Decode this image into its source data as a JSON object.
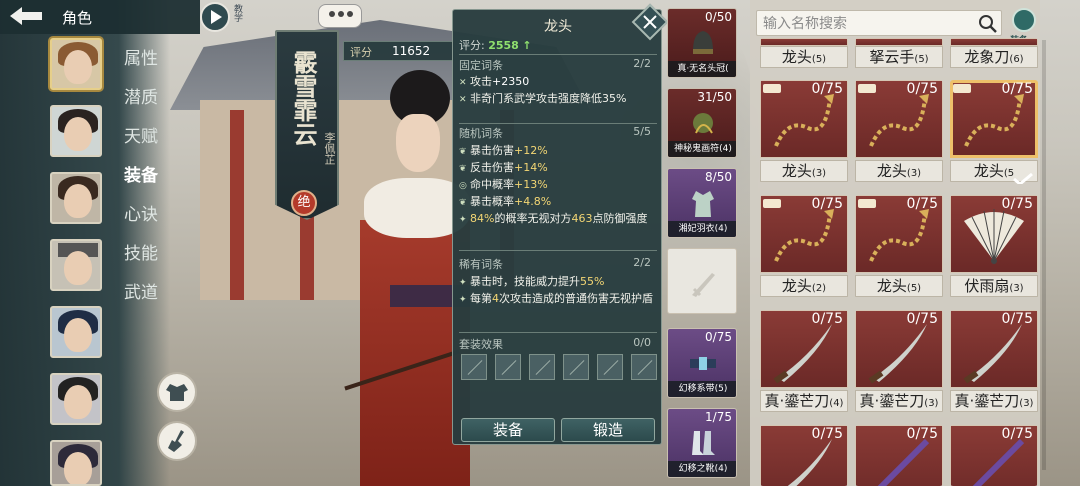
{
  "header": {
    "title": "角色",
    "tutorial_label": "教学"
  },
  "nav": {
    "items": [
      {
        "label": "属性"
      },
      {
        "label": "潜质"
      },
      {
        "label": "天赋"
      },
      {
        "label": "装备"
      },
      {
        "label": "心诀"
      },
      {
        "label": "技能"
      },
      {
        "label": "武道"
      }
    ],
    "active": "装备"
  },
  "character": {
    "name": "霰雪霏云",
    "sub_name": "李佩芷",
    "badge": "绝",
    "score_label": "评分",
    "score": "11652"
  },
  "item_panel": {
    "title": "龙头",
    "score_label": "评分:",
    "score": "2558",
    "score_arrow": "↑",
    "fixed": {
      "label": "固定词条",
      "count": "2/2",
      "attrs": [
        {
          "icon": "sword-icon",
          "text": "攻击",
          "value": "+2350"
        },
        {
          "icon": "sword-icon",
          "text": "非奇门系武学攻击强度降低35%",
          "value": ""
        }
      ]
    },
    "random": {
      "label": "随机词条",
      "count": "5/5",
      "attrs": [
        {
          "icon": "leaf-icon",
          "text": "暴击伤害",
          "value": "+12%"
        },
        {
          "icon": "leaf-icon",
          "text": "反击伤害",
          "value": "+14%"
        },
        {
          "icon": "target-icon",
          "text": "命中概率",
          "value": "+13%"
        },
        {
          "icon": "leaf-icon",
          "text": "暴击概率",
          "value": "+4.8%"
        }
      ],
      "special": {
        "pre": "84%",
        "mid": "的概率无视对方",
        "num": "463",
        "post": "点防御强度"
      }
    },
    "rare": {
      "label": "稀有词条",
      "count": "2/2",
      "attr1": {
        "pre": "暴击时，技能威力提升",
        "value": "55%"
      },
      "attr2": {
        "pre": "每第",
        "num": "4",
        "post": "次攻击造成的普通伤害无视护盾"
      }
    },
    "set": {
      "label": "套装效果",
      "count": "0/0"
    },
    "buttons": {
      "equip": "装备",
      "forge": "锻造"
    }
  },
  "mid_items": [
    {
      "count": "0/50",
      "name": "真·无名头冠(",
      "color": "red"
    },
    {
      "count": "31/50",
      "name": "神秘鬼画符(4)",
      "color": "red"
    },
    {
      "count": "8/50",
      "name": "湘妃羽衣(4)",
      "color": "purple"
    },
    {
      "count": "",
      "name": "",
      "color": "empty"
    },
    {
      "count": "0/75",
      "name": "幻移系带(5)",
      "color": "purple"
    },
    {
      "count": "1/75",
      "name": "幻移之靴(4)",
      "color": "purple"
    }
  ],
  "search": {
    "placeholder": "输入名称搜索"
  },
  "equip_toggle": {
    "label": "装备"
  },
  "grid_top": [
    {
      "name": "龙头",
      "lv": "(5)"
    },
    {
      "name": "拏云手",
      "lv": "(5)"
    },
    {
      "name": "龙象刀",
      "lv": "(6)"
    }
  ],
  "grid_rows": [
    [
      {
        "count": "0/75",
        "name": "龙头",
        "lv": "(3)",
        "icon": "chain-icon"
      },
      {
        "count": "0/75",
        "name": "龙头",
        "lv": "(3)",
        "icon": "chain-icon"
      },
      {
        "count": "0/75",
        "name": "龙头",
        "lv": "(5",
        "icon": "chain-icon",
        "selected": true
      }
    ],
    [
      {
        "count": "0/75",
        "name": "龙头",
        "lv": "(2)",
        "icon": "chain-icon"
      },
      {
        "count": "0/75",
        "name": "龙头",
        "lv": "(5)",
        "icon": "chain-icon"
      },
      {
        "count": "0/75",
        "name": "伏雨扇",
        "lv": "(3)",
        "icon": "fan-icon"
      }
    ],
    [
      {
        "count": "0/75",
        "name": "真·鎏芒刀",
        "lv": "(4)",
        "icon": "blade-icon"
      },
      {
        "count": "0/75",
        "name": "真·鎏芒刀",
        "lv": "(3)",
        "icon": "blade-icon"
      },
      {
        "count": "0/75",
        "name": "真·鎏芒刀",
        "lv": "(3)",
        "icon": "blade-icon"
      }
    ],
    [
      {
        "count": "0/75",
        "name": "",
        "lv": "",
        "icon": "blade-icon"
      },
      {
        "count": "0/75",
        "name": "",
        "lv": "",
        "icon": "staff-icon"
      },
      {
        "count": "0/75",
        "name": "",
        "lv": "",
        "icon": "staff-icon"
      }
    ]
  ],
  "colors": {
    "accent_green": "#8fdf6e",
    "accent_yellow": "#f3d674",
    "panel_bg": "#283c3e",
    "item_red": "#7a3330"
  }
}
